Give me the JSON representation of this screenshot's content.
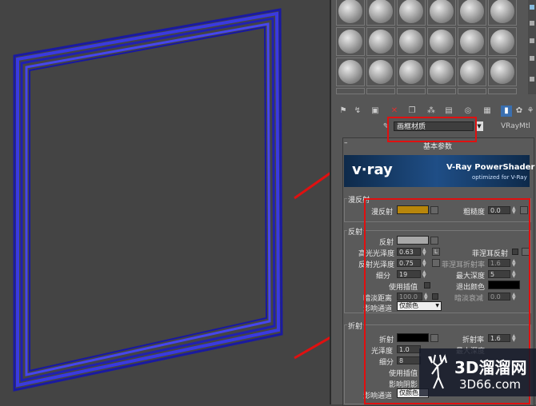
{
  "material_name": "画框材质",
  "material_type": "VRayMtl",
  "rollout_title": "基本参数",
  "vray_banner": {
    "logo": "v·ray",
    "title": "V-Ray PowerShader",
    "subtitle": "optimized for V-Ray"
  },
  "diffuse": {
    "group": "漫反射",
    "label": "漫反射",
    "roughness_label": "粗糙度",
    "roughness": "0.0",
    "color": "#b8860b"
  },
  "reflection": {
    "group": "反射",
    "reflect_label": "反射",
    "hilight_gloss_label": "高光光泽度",
    "hilight_gloss": "0.63",
    "lock": "L",
    "fresnel_label": "菲涅耳反射",
    "refl_gloss_label": "反射光泽度",
    "refl_gloss": "0.75",
    "fresnel_ior_label": "菲涅耳折射率",
    "fresnel_ior": "1.6",
    "subdivs_label": "细分",
    "subdivs": "19",
    "max_depth_label": "最大深度",
    "max_depth": "5",
    "interp_label": "使用插值",
    "exit_color_label": "退出颜色",
    "dim_dist_label": "暗淡距离",
    "dim_dist": "100.0",
    "dim_falloff_label": "暗淡衰减",
    "dim_falloff": "0.0",
    "affect_channels_label": "影响通道",
    "affect_channels": "仅颜色",
    "color": "#a8a8a8"
  },
  "refraction": {
    "group": "折射",
    "refract_label": "折射",
    "ior_label": "折射率",
    "ior": "1.6",
    "gloss_label": "光泽度",
    "gloss": "1.0",
    "max_depth_label": "最大深度",
    "subdivs_label": "细分",
    "subdivs": "8",
    "interp_label": "使用插值",
    "shadows_label": "影响阴影",
    "affect_channels_label": "影响通道",
    "affect_channels": "仅颜色"
  },
  "watermark": {
    "brand": "3D溜溜网",
    "url": "3D66.com"
  },
  "colors": {
    "frame_blue": "#2424c8",
    "highlight_red": "#e01010"
  }
}
